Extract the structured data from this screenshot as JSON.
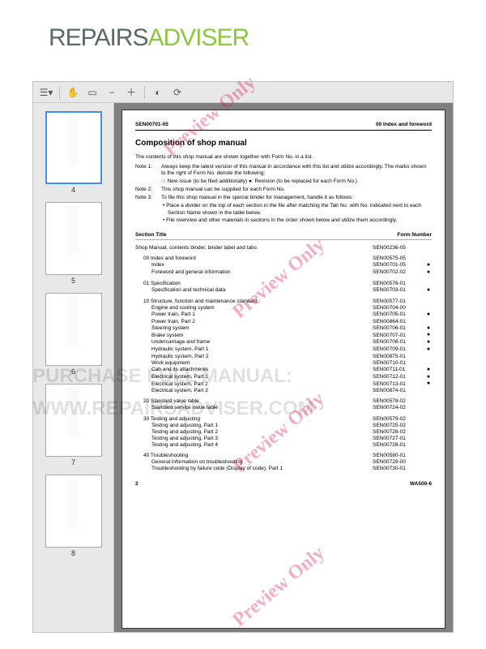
{
  "logo": {
    "part1": "REPAIRS",
    "part2": "ADVISER"
  },
  "toolbar_icons": [
    "sidebar-icon",
    "hand-icon",
    "page-icon",
    "zoom-out-icon",
    "zoom-in-icon",
    "contrast-icon",
    "rotate-icon"
  ],
  "thumbnails": [
    {
      "n": "4",
      "selected": true
    },
    {
      "n": "5",
      "selected": false
    },
    {
      "n": "6",
      "selected": false
    },
    {
      "n": "7",
      "selected": false
    },
    {
      "n": "8",
      "selected": false
    }
  ],
  "overlays": {
    "purchase": "PURCHASE FULL MANUAL:",
    "url": "WWW.REPAIRSADVISER.COM",
    "preview": "Preview Only"
  },
  "doc": {
    "header_left": "SEN00701-05",
    "header_right": "00 Index and foreword",
    "title": "Composition of shop manual",
    "intro": "The contents of this shop manual are shown together with Form No. in a list.",
    "notes": [
      {
        "label": "Note 1:",
        "text": "Always keep the latest version of this manual in accordance with this list and utilize accordingly. The marks shown to the right of Form No. denote the following:"
      },
      {
        "label": "",
        "text": "○: New issue (to be filed additionally)   ●: Revision (to be replaced for each Form No.)"
      },
      {
        "label": "Note 2:",
        "text": "This shop manual can be supplied for each Form No."
      },
      {
        "label": "Note 3:",
        "text": "To file this shop manual in the special binder for management, handle it as follows:"
      }
    ],
    "bullets": [
      "• Place a divider on the top of each section in the file after matching the Tab No. with No. indicated next to each Section Name shown in the table below.",
      "• File overview and other materials in sections in the order shown below and utilize them accordingly."
    ],
    "col_title": "Section Title",
    "col_form": "Form Number",
    "sections": [
      {
        "lvl": 0,
        "t": "Shop Manual, contents binder, binder label and tabs",
        "f": "SEN00236-05",
        "d": ""
      },
      {
        "lvl": 1,
        "t": "00 Index and foreword",
        "f": "SEN00575-05",
        "d": ""
      },
      {
        "lvl": 2,
        "t": "Index",
        "f": "SEN00701-05",
        "d": "●"
      },
      {
        "lvl": 2,
        "t": "Foreword and general information",
        "f": "SEN00702-02",
        "d": "●"
      },
      {
        "lvl": 1,
        "t": "01 Specification",
        "f": "SEN00576-01",
        "d": ""
      },
      {
        "lvl": 2,
        "t": "Specification and technical data",
        "f": "SEN00703-01",
        "d": "●"
      },
      {
        "lvl": 1,
        "t": "10 Structure, function and maintenance standard",
        "f": "SEN00577-01",
        "d": ""
      },
      {
        "lvl": 2,
        "t": "Engine and cooling system",
        "f": "SEN00704-00",
        "d": ""
      },
      {
        "lvl": 2,
        "t": "Power train, Part 1",
        "f": "SEN00705-01",
        "d": "●"
      },
      {
        "lvl": 2,
        "t": "Power train, Part 2",
        "f": "SEN00864-01",
        "d": ""
      },
      {
        "lvl": 2,
        "t": "Steering system",
        "f": "SEN00706-01",
        "d": "●"
      },
      {
        "lvl": 2,
        "t": "Brake system",
        "f": "SEN00707-01",
        "d": "●"
      },
      {
        "lvl": 2,
        "t": "Undercarriage and frame",
        "f": "SEN00708-01",
        "d": "●"
      },
      {
        "lvl": 2,
        "t": "Hydraulic system, Part 1",
        "f": "SEN00709-01",
        "d": "●"
      },
      {
        "lvl": 2,
        "t": "Hydraulic system, Part 2",
        "f": "SEN00875-01",
        "d": ""
      },
      {
        "lvl": 2,
        "t": "Work equipment",
        "f": "SEN00710-01",
        "d": ""
      },
      {
        "lvl": 2,
        "t": "Cab and its attachments",
        "f": "SEN00711-01",
        "d": "●"
      },
      {
        "lvl": 2,
        "t": "Electrical system, Part 1",
        "f": "SEN00712-01",
        "d": "●"
      },
      {
        "lvl": 2,
        "t": "Electrical system, Part 2",
        "f": "SEN00713-01",
        "d": "●"
      },
      {
        "lvl": 2,
        "t": "Electrical system, Part 3",
        "f": "SEN00874-01",
        "d": ""
      },
      {
        "lvl": 1,
        "t": "20 Standard value table",
        "f": "SEN00578-02",
        "d": ""
      },
      {
        "lvl": 2,
        "t": "Standard service value table",
        "f": "SEN00724-02",
        "d": ""
      },
      {
        "lvl": 1,
        "t": "30 Testing and adjusting",
        "f": "SEN00579-02",
        "d": ""
      },
      {
        "lvl": 2,
        "t": "Testing and adjusting, Part 1",
        "f": "SEN00725-02",
        "d": ""
      },
      {
        "lvl": 2,
        "t": "Testing and adjusting, Part 2",
        "f": "SEN00726-02",
        "d": ""
      },
      {
        "lvl": 2,
        "t": "Testing and adjusting, Part 3",
        "f": "SEN00727-01",
        "d": ""
      },
      {
        "lvl": 2,
        "t": "Testing and adjusting, Part 4",
        "f": "SEN00728-01",
        "d": ""
      },
      {
        "lvl": 1,
        "t": "40 Troubleshooting",
        "f": "SEN00580-01",
        "d": ""
      },
      {
        "lvl": 2,
        "t": "General information on troubleshooting",
        "f": "SEN00729-00",
        "d": ""
      },
      {
        "lvl": 2,
        "t": "Troubleshooting by failure code (Display of code), Part 1",
        "f": "SEN00730-01",
        "d": ""
      }
    ],
    "footer_left": "2",
    "footer_right": "WA500-6"
  }
}
